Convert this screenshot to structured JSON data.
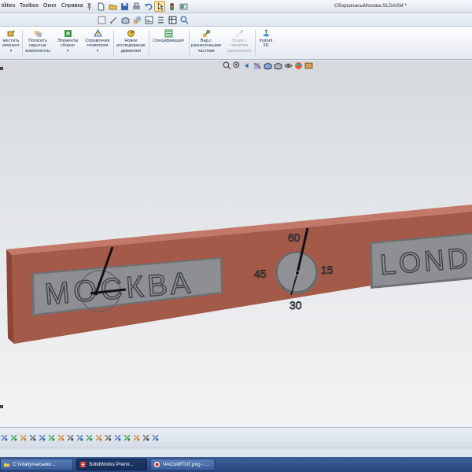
{
  "menu": {
    "items": [
      "tilities",
      "Toolbox",
      "Окно",
      "Справка"
    ],
    "document_title": "СборкачасыМосква.SLDASM *"
  },
  "command_manager": {
    "commands": [
      {
        "label": "местить\nмпонент",
        "disabled": false,
        "icon": "insert-component-icon"
      },
      {
        "label": "Погасить\nскрытые\nкомпоненты",
        "disabled": false,
        "icon": "hide-components-icon"
      },
      {
        "label": "Элементы\nсборки",
        "disabled": false,
        "icon": "assembly-features-icon"
      },
      {
        "label": "Справочная\nгеометрия",
        "disabled": false,
        "icon": "reference-geometry-icon"
      },
      {
        "label": "Новое\nисследование\nдвижения",
        "disabled": false,
        "icon": "motion-study-icon"
      },
      {
        "label": "Спецификация",
        "disabled": false,
        "icon": "bom-icon"
      },
      {
        "label": "Вид с\nразнесенными\nчастями",
        "disabled": false,
        "icon": "exploded-view-icon"
      },
      {
        "label": "Эскиз с\nлиниями\nразнесения",
        "disabled": true,
        "icon": "explode-line-sketch-icon"
      },
      {
        "label": "Instant\n3D",
        "disabled": false,
        "icon": "instant-3d-icon"
      }
    ]
  },
  "model": {
    "city_left": "МОСКВА",
    "city_right": "LOND",
    "dial_labels": {
      "top": "60",
      "left": "45",
      "right": "15",
      "bottom": "30"
    },
    "colors": {
      "board": "#a6513f",
      "plate": "#8d8f92",
      "letters": "#555b61",
      "hands": "#111111"
    }
  },
  "taskbar": {
    "tasks": [
      {
        "label": "C:\\vitaliy\\часымо...",
        "active": false
      },
      {
        "label": "SolidWorks Premi...",
        "active": true
      },
      {
        "label": "ЧАСЫИТОГ.png - ...",
        "active": false
      }
    ]
  }
}
